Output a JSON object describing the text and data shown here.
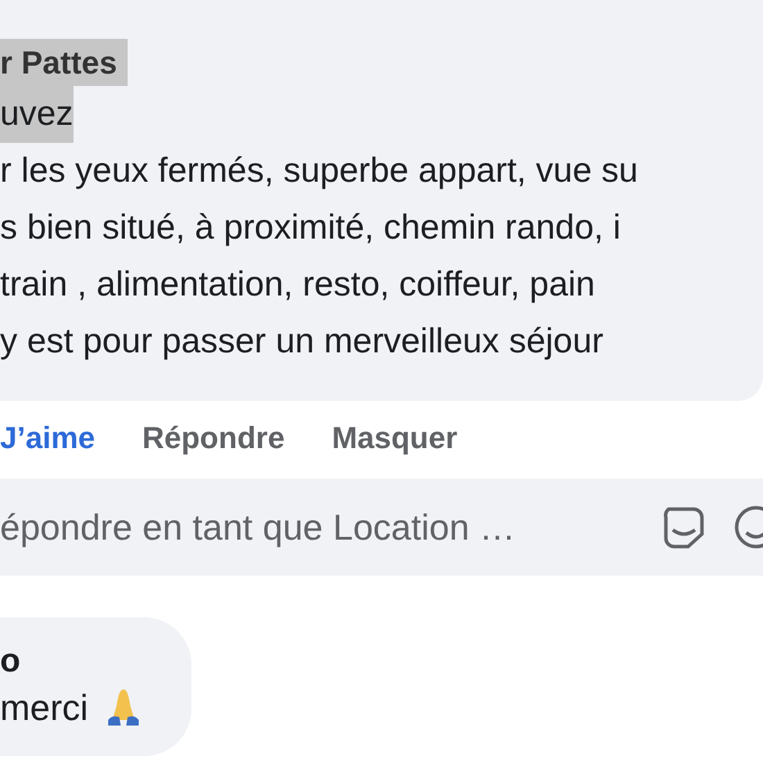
{
  "comment": {
    "author": "r Pattes",
    "author_highlighted": true,
    "lines": [
      {
        "text": "uvez",
        "highlighted": true
      },
      {
        "text": "r les yeux fermés, superbe appart, vue su",
        "highlighted": false
      },
      {
        "text": "s bien situé, à proximité, chemin rando, i",
        "highlighted": false
      },
      {
        "text": "train , alimentation, resto, coiffeur, pain",
        "highlighted": false
      },
      {
        "text": "y est pour passer un merveilleux séjour",
        "highlighted": false
      }
    ]
  },
  "actions": [
    {
      "label": "J’aime",
      "selected": true
    },
    {
      "label": "Répondre",
      "selected": false
    },
    {
      "label": "Masquer",
      "selected": false
    }
  ],
  "reply_field": {
    "placeholder": "épondre en tant que Location …"
  },
  "reply": {
    "author": "o",
    "text": "merci"
  }
}
